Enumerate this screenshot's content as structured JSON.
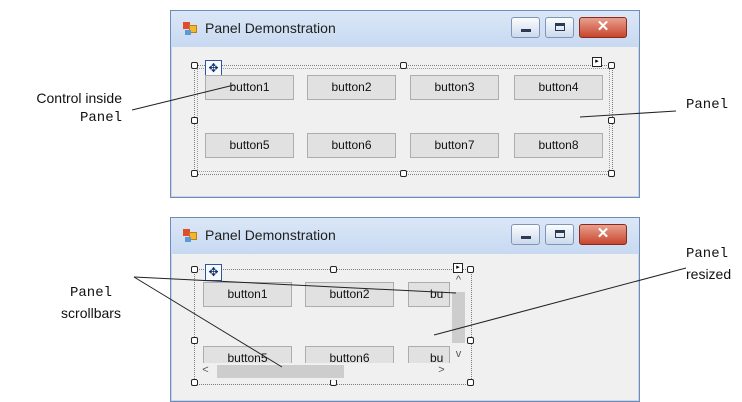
{
  "window_top": {
    "title": "Panel Demonstration",
    "buttons": [
      "button1",
      "button2",
      "button3",
      "button4",
      "button5",
      "button6",
      "button7",
      "button8"
    ]
  },
  "window_bottom": {
    "title": "Panel Demonstration",
    "buttons": [
      "button1",
      "button2",
      "bu",
      "button5",
      "button6",
      "bu"
    ]
  },
  "annotations": {
    "control_inside_line1": "Control inside",
    "control_inside_line2": "Panel",
    "panel_right": "Panel",
    "panel_resized_line1": "Panel",
    "panel_resized_line2": "resized",
    "scrollbars_line1": "Panel",
    "scrollbars_line2": "scrollbars"
  },
  "glyphs": {
    "move": "✥",
    "smart_tag": "▸",
    "close": "✕",
    "scroll_up": "^",
    "scroll_down": "v",
    "scroll_left": "<",
    "scroll_right": ">"
  },
  "colors": {
    "titlebar": "#dbe7f7",
    "close_button": "#c8452d",
    "window_border": "#6f8bb8"
  }
}
